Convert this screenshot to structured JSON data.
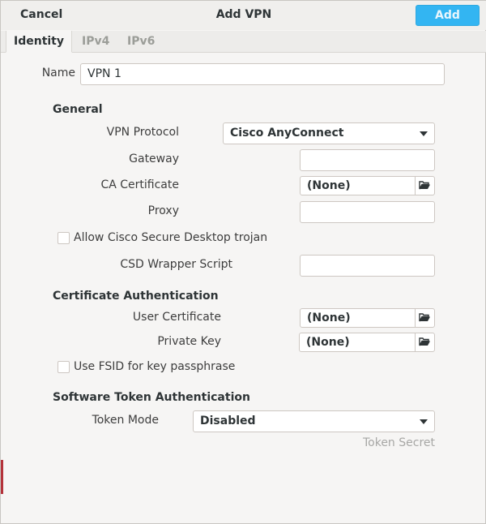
{
  "header": {
    "cancel_label": "Cancel",
    "title": "Add VPN",
    "add_label": "Add"
  },
  "tabs": [
    {
      "label": "Identity",
      "active": true
    },
    {
      "label": "IPv4",
      "active": false
    },
    {
      "label": "IPv6",
      "active": false
    }
  ],
  "name": {
    "label": "Name",
    "value": "VPN 1"
  },
  "general": {
    "heading": "General",
    "vpn_protocol": {
      "label": "VPN Protocol",
      "value": "Cisco AnyConnect"
    },
    "gateway": {
      "label": "Gateway",
      "value": ""
    },
    "ca_certificate": {
      "label": "CA Certificate",
      "value": "(None)"
    },
    "proxy": {
      "label": "Proxy",
      "value": ""
    },
    "csd_trojan": {
      "label": "Allow Cisco Secure Desktop trojan",
      "checked": false
    },
    "csd_wrapper": {
      "label": "CSD Wrapper Script",
      "value": ""
    }
  },
  "cert_auth": {
    "heading": "Certificate Authentication",
    "user_certificate": {
      "label": "User Certificate",
      "value": "(None)"
    },
    "private_key": {
      "label": "Private Key",
      "value": "(None)"
    },
    "fsid": {
      "label": "Use FSID for key passphrase",
      "checked": false
    }
  },
  "token_auth": {
    "heading": "Software Token Authentication",
    "token_mode": {
      "label": "Token Mode",
      "value": "Disabled"
    },
    "token_secret": {
      "label": "Token Secret"
    }
  },
  "icons": {
    "file_chooser": "folder-open-icon",
    "dropdown": "chevron-down-icon"
  },
  "colors": {
    "accent": "#33b5f2",
    "background": "#f6f5f4"
  }
}
